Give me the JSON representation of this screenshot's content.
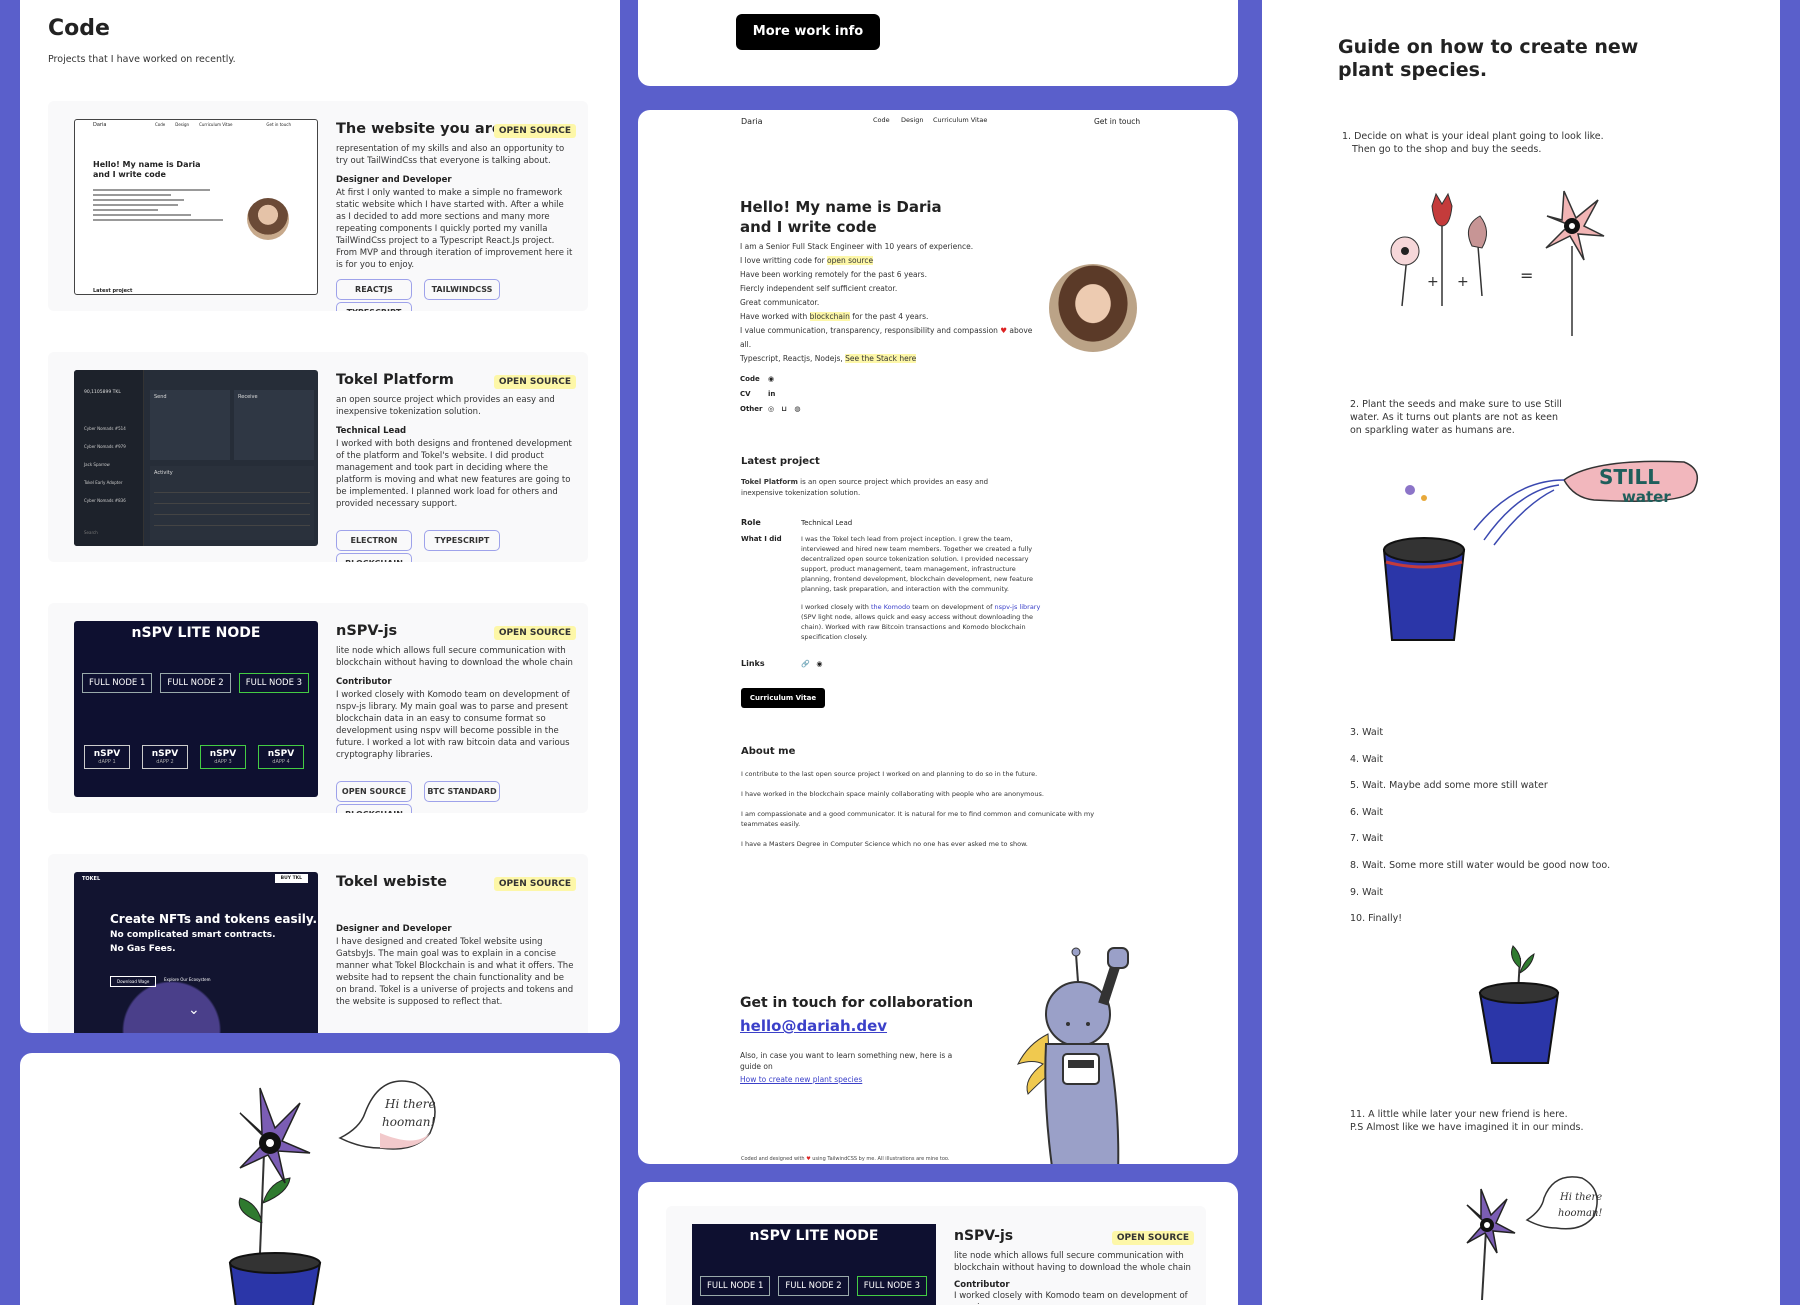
{
  "left_panel": {
    "title": "Code",
    "subtitle": "Projects that I have worked on recently.",
    "projects": [
      {
        "title": "The website you are on",
        "tag": "OPEN SOURCE",
        "description": "representation of my skills and also an opportunity to try out TailWindCss that everyone is talking about.",
        "role": "Designer and Developer",
        "text": "At first I only wanted to make a simple no framework static website which I have started with. After a while as I decided to add more sections and many more repeating components I quickly ported my vanilla TailWindCss project to a Typescript React.Js project. From MVP and through iteration of improvement here it is for you to enjoy.",
        "pills": [
          "REACTJS",
          "TAILWINDCSS",
          "TYPESCRIPT"
        ],
        "thumb": {
          "brand": "Daria",
          "nav": [
            "Code",
            "Design",
            "Curriculum Vitae"
          ],
          "cta": "Get in touch",
          "headline": "Hello! My name is Daria and I write code",
          "latest": "Latest project"
        }
      },
      {
        "title": "Tokel Platform",
        "tag": "OPEN SOURCE",
        "description": "an open source project which provides an easy and inexpensive tokenization solution.",
        "role": "Technical Lead",
        "text": "I worked with both designs and frontened development of the platform and Tokel's website. I did product management and took part in deciding where the platform is moving and what new features are going to be implemented. I planned work load for others and provided necessary support.",
        "pills": [
          "ELECTRON",
          "TYPESCRIPT",
          "BLOCKCHAIN"
        ],
        "thumb": {
          "balance": "90,1105899 TKL",
          "items": [
            "Cyber Nomads #514",
            "Cyber Nomads #979",
            "Jack Sparrow",
            "Tokel Early Adopter",
            "Cyber Nomads #836"
          ],
          "send": "Send",
          "receive": "Receive",
          "activity": "Activity",
          "search": "Search"
        }
      },
      {
        "title": "nSPV-js",
        "tag": "OPEN SOURCE",
        "description": "lite node which allows full secure communication with blockchain without having to download the whole chain",
        "role": "Contributor",
        "text": "I worked closely with Komodo team on development of nspv-js library. My main goal was to parse and present blockchain data in an easy to consume format so development using nspv will become possible in the future. I worked a lot with raw bitcoin data and various cryptography libraries.",
        "pills": [
          "OPEN SOURCE",
          "BTC STANDARD",
          "BLOCKCHAIN"
        ],
        "thumb": {
          "heading": "nSPV LITE NODE",
          "nodes": [
            "FULL NODE 1",
            "FULL NODE 2",
            "FULL NODE 3"
          ],
          "nspv": [
            "nSPV",
            "nSPV",
            "nSPV",
            "nSPV"
          ],
          "dapps": [
            "dAPP 1",
            "dAPP 2",
            "dAPP 3",
            "dAPP 4"
          ]
        }
      },
      {
        "title": "Tokel webiste",
        "tag": "OPEN SOURCE",
        "description": "",
        "role": "Designer and Developer",
        "text": "I have designed and created Tokel website using GatsbyJs. The main goal was to explain in a concise manner what Tokel Blockchain is and what it offers. The website had to repsent the chain functionality and be on brand. Tokel is a universe of projects and tokens and the website is supposed to reflect that.",
        "thumb": {
          "brand": "TOKEL",
          "buy": "BUY TKL",
          "line1": "Create NFTs and tokens easily.",
          "line2": "No complicated smart contracts.",
          "line3": "No Gas Fees.",
          "btn1": "Download Wage",
          "btn2": "Explore Our Ecosystem"
        }
      }
    ]
  },
  "bottom_left": {
    "bubble1": "Hi there",
    "bubble2": "hooman!"
  },
  "middle_top": {
    "button": "More work info"
  },
  "middle_main": {
    "nav": {
      "brand": "Daria",
      "links": [
        "Code",
        "Design",
        "Curriculum Vitae"
      ],
      "cta": "Get in touch"
    },
    "heading": "Hello! My name is Daria and I write code",
    "bio": {
      "l1": "I am a Senior Full Stack Engineer with 10 years of experience.",
      "l2a": "I love writting code for ",
      "l2b": "open source",
      "l3": "Have been working remotely for the past 6 years.",
      "l4": "Fiercly independent self sufficient creator.",
      "l5": "Great communicator.",
      "l6a": "Have worked with ",
      "l6b": "blockchain",
      "l6c": " for the past 4 years.",
      "l7a": "I value communication, transparency, responsibility and compassion ",
      "l7b": " above all."
    },
    "stack": {
      "text": "Typescript, Reactjs, Nodejs, ",
      "link": "See the Stack here"
    },
    "social": {
      "code": "Code",
      "cv": "CV",
      "other": "Other"
    },
    "latest": {
      "title": "Latest project",
      "intro_bold": "Tokel Platform",
      "intro": " is an open source project which provides an easy and inexpensive tokenization solution.",
      "role_label": "Role",
      "role": "Technical Lead",
      "did_label": "What I did",
      "did1": "I was the Tokel tech lead from project inception. I grew the team, interviewed and hired new team members. Together we created a fully decentralized open source tokenization solution. I provided necessary support, product management, team management, infrastructure planning, frontend development, blockchain development, new feature planning, task preparation, and interaction with the community.",
      "did2a": "I worked closely with ",
      "did2b": "the Komodo",
      "did2c": " team on development of ",
      "did2d": "nspv-js library",
      "did2e": " (SPV light node, allows quick and easy access without downloading the chain). Worked with raw Bitcoin transactions and Komodo blockchain specification closely.",
      "links_label": "Links",
      "cv_button": "Curriculum Vitae"
    },
    "about": {
      "title": "About me",
      "p1": "I contribute to the last open source project I worked on and planning to do so in the future.",
      "p2": "I have worked in the blockchain space mainly collaborating with people who are anonymous.",
      "p3": "I am compassionate and a good communicator. It is natural for me to find common and comunicate with my teammates easily.",
      "p4": "I have a Masters Degree in Computer Science which no one has ever asked me to show."
    },
    "contact": {
      "title": "Get in touch for collaboration",
      "email": "hello@dariah.dev",
      "text": "Also, in case you want to learn something new, here is a guide on",
      "link": "How to create new plant species"
    },
    "footer": {
      "a": "Coded and designed with ",
      "b": " using TailwindCSS by me. All illustrations are mine too."
    }
  },
  "middle_bottom": {
    "thumb_heading": "nSPV LITE NODE",
    "nodes": [
      "FULL NODE 1",
      "FULL NODE 2",
      "FULL NODE 3"
    ],
    "title": "nSPV-js",
    "tag": "OPEN SOURCE",
    "description": "lite node which allows full secure communication with blockchain without having to download the whole chain",
    "role": "Contributor",
    "text": "I worked closely with Komodo team on development of nspv-js"
  },
  "right_panel": {
    "title": "Guide on how to create new plant species.",
    "step1a": "1. Decide on what is your ideal plant going to look like.",
    "step1b": "Then go to the shop and buy the seeds.",
    "step2": "2. Plant the seeds and make sure to use Still water. As it turns out plants are not as keen on sparkling water as humans are.",
    "bottle1": "STILL",
    "bottle2": "water",
    "steps": [
      "3. Wait",
      "4. Wait",
      "5. Wait. Maybe add some more still water",
      "6. Wait",
      "7. Wait",
      "8. Wait. Some more still water would be good now too.",
      "9. Wait",
      "10. Finally!"
    ],
    "step11a": "11. A little while later your new friend is here.",
    "step11b": "P.S Almost like we have imagined it in our minds.",
    "bubble1": "Hi there",
    "bubble2": "hooman!"
  },
  "colors": {
    "background": "#5a5fcb",
    "highlight": "#fdf7a8",
    "pill_border": "#9ea2ea",
    "accent": "#3b40c9"
  }
}
